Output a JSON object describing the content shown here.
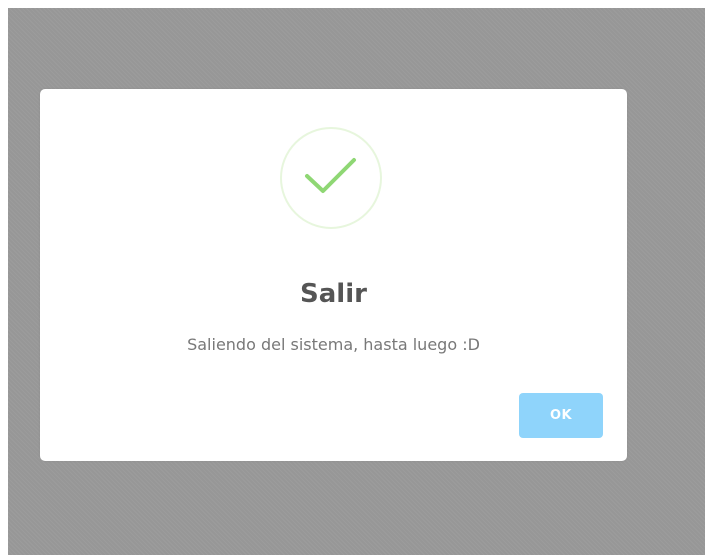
{
  "dialog": {
    "icon": "success-check-icon",
    "title": "Salir",
    "message": "Saliendo del sistema, hasta luego :D",
    "ok_label": "OK"
  },
  "colors": {
    "overlay": "#979797",
    "check": "#8fd774",
    "ring": "#e7f6dd",
    "button": "#8fd4fb"
  }
}
